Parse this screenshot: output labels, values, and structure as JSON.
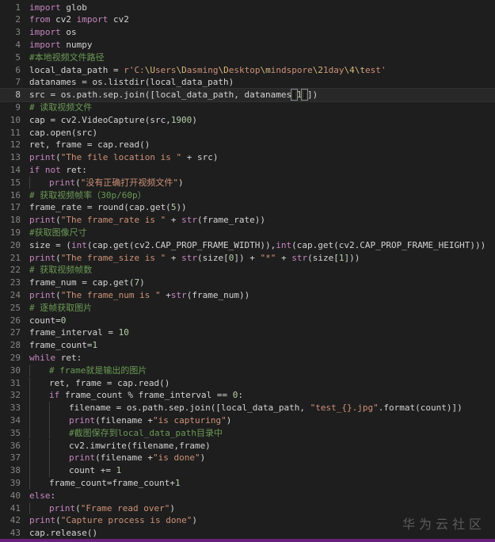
{
  "editor": {
    "current_line": 8,
    "lines": [
      {
        "n": "1",
        "indent": 0,
        "tokens": [
          [
            "kw",
            "import"
          ],
          [
            "t",
            " glob"
          ]
        ]
      },
      {
        "n": "2",
        "indent": 0,
        "tokens": [
          [
            "kw",
            "from"
          ],
          [
            "t",
            " cv2 "
          ],
          [
            "kw",
            "import"
          ],
          [
            "t",
            " cv2"
          ]
        ]
      },
      {
        "n": "3",
        "indent": 0,
        "tokens": [
          [
            "kw",
            "import"
          ],
          [
            "t",
            " os"
          ]
        ]
      },
      {
        "n": "4",
        "indent": 0,
        "tokens": [
          [
            "kw",
            "import"
          ],
          [
            "t",
            " numpy"
          ]
        ]
      },
      {
        "n": "5",
        "indent": 0,
        "tokens": [
          [
            "cm",
            "#本地视频文件路径"
          ]
        ]
      },
      {
        "n": "6",
        "indent": 0,
        "tokens": [
          [
            "t",
            "local_data_path = "
          ],
          [
            "str",
            "r'C:"
          ],
          [
            "esc",
            "\\U"
          ],
          [
            "str",
            "sers"
          ],
          [
            "esc",
            "\\D"
          ],
          [
            "str",
            "asming"
          ],
          [
            "esc",
            "\\D"
          ],
          [
            "str",
            "esktop"
          ],
          [
            "esc",
            "\\m"
          ],
          [
            "str",
            "indspore"
          ],
          [
            "esc",
            "\\2"
          ],
          [
            "str",
            "1day"
          ],
          [
            "esc",
            "\\4"
          ],
          [
            "esc",
            "\\t"
          ],
          [
            "str",
            "est'"
          ]
        ]
      },
      {
        "n": "7",
        "indent": 0,
        "tokens": [
          [
            "t",
            "datanames = os.listdir(local_data_path)"
          ]
        ]
      },
      {
        "n": "8",
        "indent": 0,
        "tokens": [
          [
            "t",
            "src = os.path.sep.join([local_data_path, datanames"
          ],
          [
            "bh",
            "["
          ],
          [
            "num",
            "1"
          ],
          [
            "bh",
            "]"
          ],
          [
            "t",
            "])"
          ]
        ]
      },
      {
        "n": "9",
        "indent": 0,
        "tokens": [
          [
            "cm",
            "# 读取视频文件"
          ]
        ]
      },
      {
        "n": "10",
        "indent": 0,
        "tokens": [
          [
            "t",
            "cap = cv2.VideoCapture(src,"
          ],
          [
            "num",
            "1900"
          ],
          [
            "t",
            ")"
          ]
        ]
      },
      {
        "n": "11",
        "indent": 0,
        "tokens": [
          [
            "t",
            "cap.open(src)"
          ]
        ]
      },
      {
        "n": "12",
        "indent": 0,
        "tokens": [
          [
            "t",
            "ret, frame = cap.read()"
          ]
        ]
      },
      {
        "n": "13",
        "indent": 0,
        "tokens": [
          [
            "bi",
            "print"
          ],
          [
            "t",
            "("
          ],
          [
            "str",
            "\"The file location is \""
          ],
          [
            "t",
            " + src)"
          ]
        ]
      },
      {
        "n": "14",
        "indent": 0,
        "tokens": [
          [
            "kw",
            "if"
          ],
          [
            "t",
            " "
          ],
          [
            "kw",
            "not"
          ],
          [
            "t",
            " ret:"
          ]
        ]
      },
      {
        "n": "15",
        "indent": 1,
        "tokens": [
          [
            "bi",
            "print"
          ],
          [
            "t",
            "("
          ],
          [
            "str",
            "\"没有正确打开视频文件\""
          ],
          [
            "t",
            ")"
          ]
        ]
      },
      {
        "n": "16",
        "indent": 0,
        "tokens": [
          [
            "cm",
            "# 获取视频帧率（30p/60p）"
          ]
        ]
      },
      {
        "n": "17",
        "indent": 0,
        "tokens": [
          [
            "t",
            "frame_rate = round(cap.get("
          ],
          [
            "num",
            "5"
          ],
          [
            "t",
            "))"
          ]
        ]
      },
      {
        "n": "18",
        "indent": 0,
        "tokens": [
          [
            "bi",
            "print"
          ],
          [
            "t",
            "("
          ],
          [
            "str",
            "\"The frame_rate is \""
          ],
          [
            "t",
            " + "
          ],
          [
            "bi",
            "str"
          ],
          [
            "t",
            "(frame_rate))"
          ]
        ]
      },
      {
        "n": "19",
        "indent": 0,
        "tokens": [
          [
            "cm",
            "#获取图像尺寸"
          ]
        ]
      },
      {
        "n": "20",
        "indent": 0,
        "tokens": [
          [
            "t",
            "size = ("
          ],
          [
            "bi",
            "int"
          ],
          [
            "t",
            "(cap.get(cv2.CAP_PROP_FRAME_WIDTH)),"
          ],
          [
            "bi",
            "int"
          ],
          [
            "t",
            "(cap.get(cv2.CAP_PROP_FRAME_HEIGHT)))"
          ]
        ]
      },
      {
        "n": "21",
        "indent": 0,
        "tokens": [
          [
            "bi",
            "print"
          ],
          [
            "t",
            "("
          ],
          [
            "str",
            "\"The frame_size is \""
          ],
          [
            "t",
            " + "
          ],
          [
            "bi",
            "str"
          ],
          [
            "t",
            "(size["
          ],
          [
            "num",
            "0"
          ],
          [
            "t",
            "]) + "
          ],
          [
            "str",
            "\"*\""
          ],
          [
            "t",
            " + "
          ],
          [
            "bi",
            "str"
          ],
          [
            "t",
            "(size["
          ],
          [
            "num",
            "1"
          ],
          [
            "t",
            "]))"
          ]
        ]
      },
      {
        "n": "22",
        "indent": 0,
        "tokens": [
          [
            "cm",
            "# 获取视频帧数"
          ]
        ]
      },
      {
        "n": "23",
        "indent": 0,
        "tokens": [
          [
            "t",
            "frame_num = cap.get("
          ],
          [
            "num",
            "7"
          ],
          [
            "t",
            ")"
          ]
        ]
      },
      {
        "n": "24",
        "indent": 0,
        "tokens": [
          [
            "bi",
            "print"
          ],
          [
            "t",
            "("
          ],
          [
            "str",
            "\"The frame_num is \""
          ],
          [
            "t",
            " +"
          ],
          [
            "bi",
            "str"
          ],
          [
            "t",
            "(frame_num))"
          ]
        ]
      },
      {
        "n": "25",
        "indent": 0,
        "tokens": [
          [
            "cm",
            "# 逐帧获取图片"
          ]
        ]
      },
      {
        "n": "26",
        "indent": 0,
        "tokens": [
          [
            "t",
            "count="
          ],
          [
            "num",
            "0"
          ]
        ]
      },
      {
        "n": "27",
        "indent": 0,
        "tokens": [
          [
            "t",
            "frame_interval = "
          ],
          [
            "num",
            "10"
          ]
        ]
      },
      {
        "n": "28",
        "indent": 0,
        "tokens": [
          [
            "t",
            "frame_count="
          ],
          [
            "num",
            "1"
          ]
        ]
      },
      {
        "n": "29",
        "indent": 0,
        "tokens": [
          [
            "kw",
            "while"
          ],
          [
            "t",
            " ret:"
          ]
        ]
      },
      {
        "n": "30",
        "indent": 1,
        "tokens": [
          [
            "cm",
            "# frame就是输出的图片"
          ]
        ]
      },
      {
        "n": "31",
        "indent": 1,
        "tokens": [
          [
            "t",
            "ret, frame = cap.read()"
          ]
        ]
      },
      {
        "n": "32",
        "indent": 1,
        "tokens": [
          [
            "kw",
            "if"
          ],
          [
            "t",
            " frame_count % frame_interval == "
          ],
          [
            "num",
            "0"
          ],
          [
            "t",
            ":"
          ]
        ]
      },
      {
        "n": "33",
        "indent": 2,
        "tokens": [
          [
            "t",
            "filename = os.path.sep.join([local_data_path, "
          ],
          [
            "str",
            "\"test_{}.jpg\""
          ],
          [
            "t",
            ".format(count)])"
          ]
        ]
      },
      {
        "n": "34",
        "indent": 2,
        "tokens": [
          [
            "bi",
            "print"
          ],
          [
            "t",
            "(filename +"
          ],
          [
            "str",
            "\"is capturing\""
          ],
          [
            "t",
            ")"
          ]
        ]
      },
      {
        "n": "35",
        "indent": 2,
        "tokens": [
          [
            "cm",
            "#截图保存到local_data_path目录中"
          ]
        ]
      },
      {
        "n": "36",
        "indent": 2,
        "tokens": [
          [
            "t",
            "cv2.imwrite(filename,frame)"
          ]
        ]
      },
      {
        "n": "37",
        "indent": 2,
        "tokens": [
          [
            "bi",
            "print"
          ],
          [
            "t",
            "(filename +"
          ],
          [
            "str",
            "\"is done\""
          ],
          [
            "t",
            ")"
          ]
        ]
      },
      {
        "n": "38",
        "indent": 2,
        "tokens": [
          [
            "t",
            "count += "
          ],
          [
            "num",
            "1"
          ]
        ]
      },
      {
        "n": "39",
        "indent": 1,
        "tokens": [
          [
            "t",
            "frame_count=frame_count+"
          ],
          [
            "num",
            "1"
          ]
        ]
      },
      {
        "n": "40",
        "indent": 0,
        "tokens": [
          [
            "kw",
            "else"
          ],
          [
            "t",
            ":"
          ]
        ]
      },
      {
        "n": "41",
        "indent": 1,
        "tokens": [
          [
            "bi",
            "print"
          ],
          [
            "t",
            "("
          ],
          [
            "str",
            "\"Frame read over\""
          ],
          [
            "t",
            ")"
          ]
        ]
      },
      {
        "n": "42",
        "indent": 0,
        "tokens": [
          [
            "bi",
            "print"
          ],
          [
            "t",
            "("
          ],
          [
            "str",
            "\"Capture process is done\""
          ],
          [
            "t",
            ")"
          ]
        ]
      },
      {
        "n": "43",
        "indent": 0,
        "tokens": [
          [
            "t",
            "cap.release()"
          ]
        ]
      }
    ]
  },
  "watermark": {
    "text": "华为云社区"
  },
  "colors": {
    "background": "#1e1e1e",
    "keyword": "#c586c0",
    "string": "#ce9178",
    "number": "#b5cea8",
    "comment": "#6a9955",
    "text": "#d4d4d4",
    "line_number": "#858585"
  }
}
